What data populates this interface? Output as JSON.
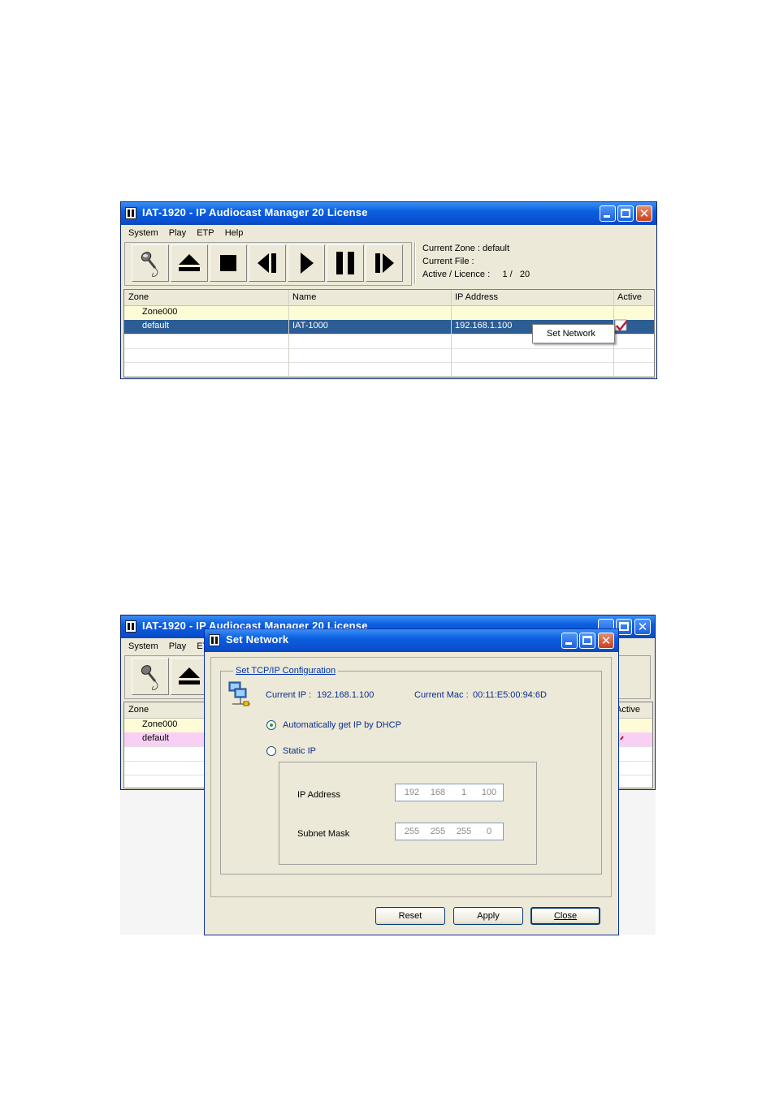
{
  "app_title": "IAT-1920 - IP Audiocast Manager 20 License",
  "menu": [
    "System",
    "Play",
    "ETP",
    "Help"
  ],
  "status": {
    "zone_label": "Current Zone :",
    "zone_value": "default",
    "file_label": "Current File :",
    "file_value": "",
    "active_label": "Active / Licence :",
    "active_value": "1 /   20"
  },
  "columns": [
    "Zone",
    "Name",
    "IP Address",
    "Active"
  ],
  "rows": [
    {
      "zone": "Zone000",
      "name": "",
      "ip": "",
      "active": ""
    },
    {
      "zone": "default",
      "name": "IAT-1000",
      "ip": "192.168.1.100",
      "active": "checked"
    }
  ],
  "context_menu": [
    "Set Network"
  ],
  "back_window": {
    "title_visible": "IAT-1920 - IP Audiocast Manager 20 License",
    "menu_visible": [
      "System",
      "Play",
      "ET"
    ],
    "zone_header": "Zone",
    "active_header": "Active",
    "rows": [
      "Zone000",
      "default"
    ]
  },
  "dialog": {
    "title": "Set Network",
    "group_title": "Set TCP/IP Configuration",
    "current_ip_label": "Current IP :",
    "current_ip": "192.168.1.100",
    "current_mac_label": "Current Mac :",
    "current_mac": "00:11:E5:00:94:6D",
    "dhcp_label": "Automatically get IP by DHCP",
    "dhcp_selected": true,
    "static_label": "Static IP",
    "ip_address_label": "IP Address",
    "ip_address": [
      "192",
      "168",
      "1",
      "100"
    ],
    "subnet_label": "Subnet Mask",
    "subnet": [
      "255",
      "255",
      "255",
      "0"
    ],
    "buttons": [
      "Reset",
      "Apply",
      "Close"
    ]
  },
  "colors": {
    "zone_row": "#fefcd6",
    "selected_row": "#2c5d94",
    "default_row_pink": "#f9d0f5",
    "check_red": "#c0183c"
  }
}
